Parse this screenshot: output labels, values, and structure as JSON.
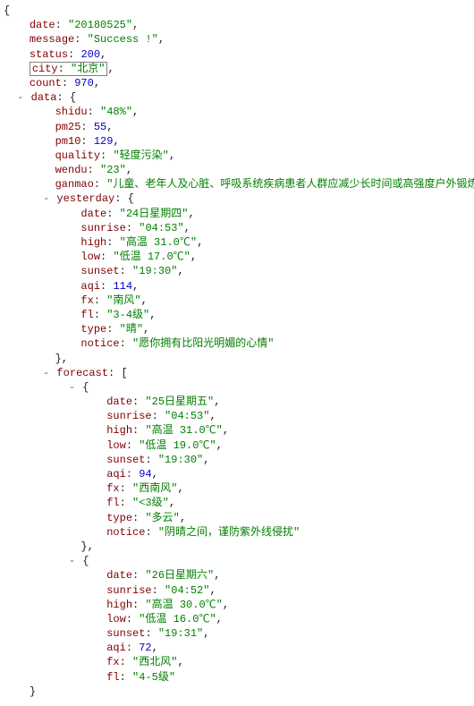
{
  "indent": "    ",
  "root": {
    "date": {
      "type": "str",
      "value": "20180525"
    },
    "message": {
      "type": "str",
      "value": "Success !"
    },
    "status": {
      "type": "num",
      "value": "200"
    },
    "city": {
      "type": "str",
      "value": "北京",
      "boxed": true
    },
    "count": {
      "type": "num",
      "value": "970"
    },
    "data": {
      "type": "obj",
      "collapsed": false,
      "children": {
        "shidu": {
          "type": "str",
          "value": "48%"
        },
        "pm25": {
          "type": "num",
          "value": "55"
        },
        "pm10": {
          "type": "num",
          "value": "129"
        },
        "quality": {
          "type": "str",
          "value": "轻度污染"
        },
        "wendu": {
          "type": "str",
          "value": "23"
        },
        "ganmao": {
          "type": "str",
          "value": "儿童、老年人及心脏、呼吸系统疾病患者人群应减少长时间或高强度户外锻炼"
        },
        "yesterday": {
          "type": "obj",
          "collapsed": false,
          "children": {
            "date": {
              "type": "str",
              "value": "24日星期四"
            },
            "sunrise": {
              "type": "str",
              "value": "04:53"
            },
            "high": {
              "type": "str",
              "value": "高温 31.0℃"
            },
            "low": {
              "type": "str",
              "value": "低温 17.0℃"
            },
            "sunset": {
              "type": "str",
              "value": "19:30"
            },
            "aqi": {
              "type": "num",
              "value": "114"
            },
            "fx": {
              "type": "str",
              "value": "南风"
            },
            "fl": {
              "type": "str",
              "value": "3-4级"
            },
            "type": {
              "type": "str",
              "value": "晴"
            },
            "notice": {
              "type": "str",
              "value": "愿你拥有比阳光明媚的心情"
            }
          }
        },
        "forecast": {
          "type": "arr",
          "collapsed": false,
          "items": [
            {
              "type": "obj",
              "collapsed": false,
              "children": {
                "date": {
                  "type": "str",
                  "value": "25日星期五"
                },
                "sunrise": {
                  "type": "str",
                  "value": "04:53"
                },
                "high": {
                  "type": "str",
                  "value": "高温 31.0℃"
                },
                "low": {
                  "type": "str",
                  "value": "低温 19.0℃"
                },
                "sunset": {
                  "type": "str",
                  "value": "19:30"
                },
                "aqi": {
                  "type": "num",
                  "value": "94"
                },
                "fx": {
                  "type": "str",
                  "value": "西南风"
                },
                "fl": {
                  "type": "str",
                  "value": "<3级"
                },
                "type": {
                  "type": "str",
                  "value": "多云"
                },
                "notice": {
                  "type": "str",
                  "value": "阴晴之间，谨防紫外线侵扰"
                }
              }
            },
            {
              "type": "obj",
              "collapsed": false,
              "truncated": true,
              "children": {
                "date": {
                  "type": "str",
                  "value": "26日星期六"
                },
                "sunrise": {
                  "type": "str",
                  "value": "04:52"
                },
                "high": {
                  "type": "str",
                  "value": "高温 30.0℃"
                },
                "low": {
                  "type": "str",
                  "value": "低温 16.0℃"
                },
                "sunset": {
                  "type": "str",
                  "value": "19:31"
                },
                "aqi": {
                  "type": "num",
                  "value": "72"
                },
                "fx": {
                  "type": "str",
                  "value": "西北风"
                },
                "fl": {
                  "type": "str",
                  "value": "4-5级"
                }
              }
            }
          ]
        }
      }
    }
  }
}
